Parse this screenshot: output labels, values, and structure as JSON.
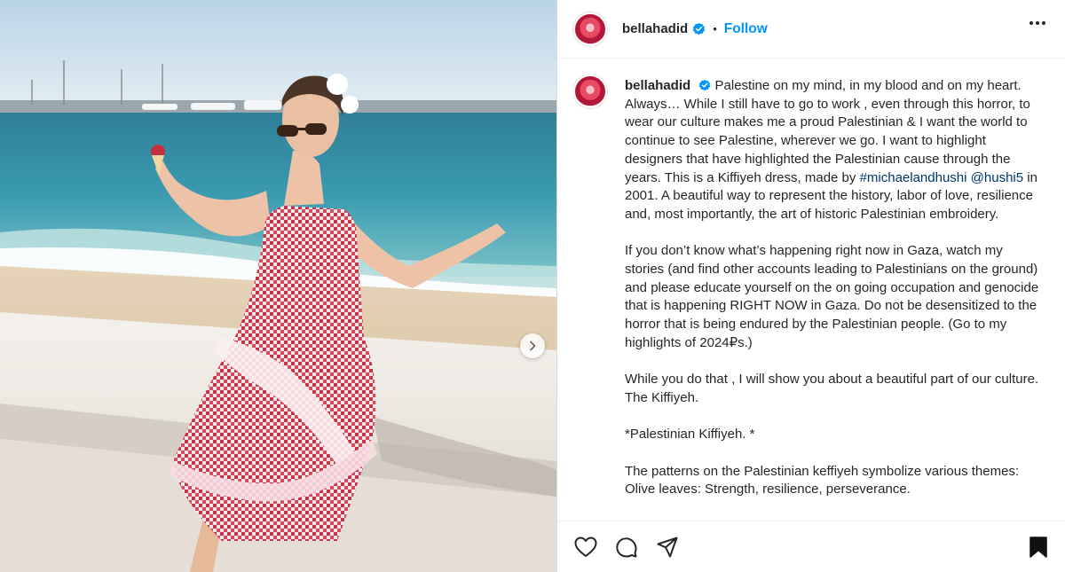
{
  "post": {
    "username": "bellahadid",
    "follow_label": "Follow",
    "separator": "•",
    "caption_paragraphs": [
      {
        "lead": "Palestine on my mind, in my blood and on my heart. Always… While I still have to go to work , even through this horror, to wear our culture makes me a proud Palestinian & I want the world to continue to see Palestine, wherever we go. I want to highlight designers that have highlighted the Palestinian cause through the years. This is a Kiffiyeh dress, made by ",
        "hashtag": "#michaelandhushi",
        "mention": "@hushi5",
        "tail": " in 2001. A beautiful way to represent the history, labor of love, resilience and, most importantly, the art of historic Palestinian embroidery."
      }
    ],
    "para2": "If you don’t know what’s happening right now in Gaza, watch my stories (and find other accounts leading to Palestinians on the ground) and please educate yourself on the on going occupation and genocide that is happening RIGHT NOW in Gaza. Do not be desensitized to the horror that is being endured by the Palestinian people. (Go to my highlights of 2024₽s.)",
    "para3": "While you do that , I will show you about a beautiful part of our culture. The Kiffiyeh.",
    "para4": "*Palestinian Kiffiyeh. *",
    "para5": "The patterns on the Palestinian keffiyeh symbolize various themes: Olive leaves: Strength, resilience, perseverance."
  },
  "icons": {
    "verified": "verified-badge-icon",
    "more": "more-options-icon",
    "like": "heart-icon",
    "comment": "comment-icon",
    "share": "share-icon",
    "save": "bookmark-icon",
    "carousel": "chevron-right-icon"
  },
  "colors": {
    "accent": "#0095f6",
    "link": "#00376b",
    "text": "#262626"
  }
}
